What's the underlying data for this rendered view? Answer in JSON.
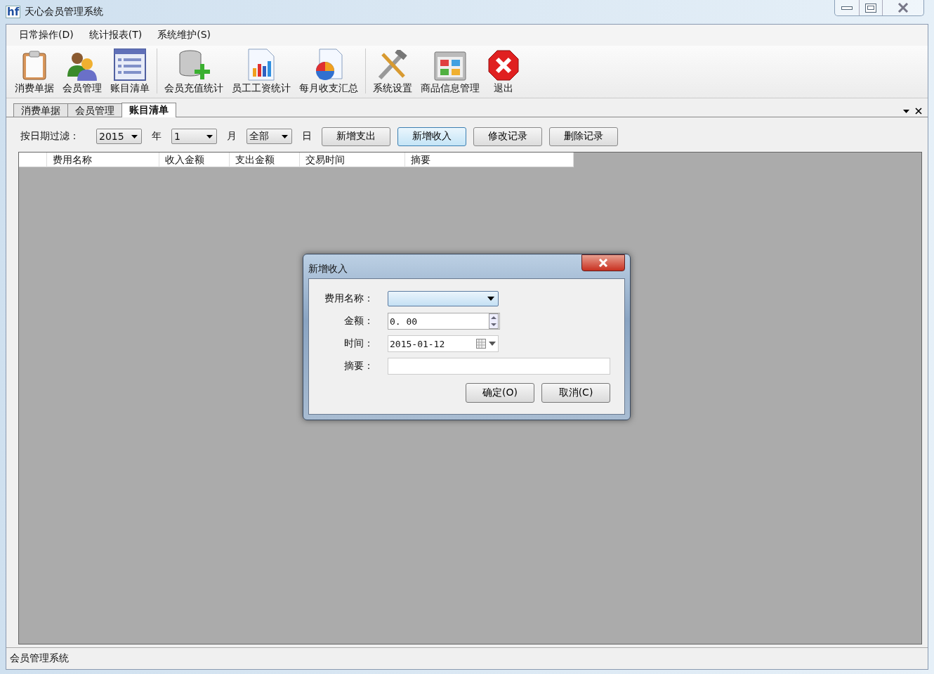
{
  "window": {
    "logo": "hf",
    "title": "天心会员管理系统"
  },
  "menu": [
    "日常操作(D)",
    "统计报表(T)",
    "系统维护(S)"
  ],
  "toolbar_groups": [
    [
      {
        "label": "消费单据"
      },
      {
        "label": "会员管理"
      },
      {
        "label": "账目清单"
      }
    ],
    [
      {
        "label": "会员充值统计"
      },
      {
        "label": "员工工资统计"
      },
      {
        "label": "每月收支汇总"
      }
    ],
    [
      {
        "label": "系统设置"
      },
      {
        "label": "商品信息管理"
      },
      {
        "label": "退出"
      }
    ]
  ],
  "tabs": [
    {
      "label": "消费单据",
      "selected": false
    },
    {
      "label": "会员管理",
      "selected": false
    },
    {
      "label": "账目清单",
      "selected": true
    }
  ],
  "filter": {
    "label": "按日期过滤：",
    "year": "2015",
    "year_unit": "年",
    "month": "1",
    "month_unit": "月",
    "day": "全部",
    "day_unit": "日",
    "buttons": [
      {
        "label": "新增支出",
        "focused": false
      },
      {
        "label": "新增收入",
        "focused": true
      },
      {
        "label": "修改记录",
        "focused": false
      },
      {
        "label": "删除记录",
        "focused": false
      }
    ]
  },
  "table": {
    "columns": [
      "费用名称",
      "收入金额",
      "支出金额",
      "交易时间",
      "摘要"
    ]
  },
  "dialog": {
    "title": "新增收入",
    "fields": [
      {
        "kind": "combo",
        "label": "费用名称："
      },
      {
        "kind": "spinner",
        "label": "金额：",
        "value": "0. 00"
      },
      {
        "kind": "date",
        "label": "时间：",
        "value": "2015-01-12"
      },
      {
        "kind": "text",
        "label": "摘要："
      }
    ],
    "buttons": [
      "确定(O)",
      "取消(C)"
    ]
  },
  "status_bar": "会员管理系统"
}
